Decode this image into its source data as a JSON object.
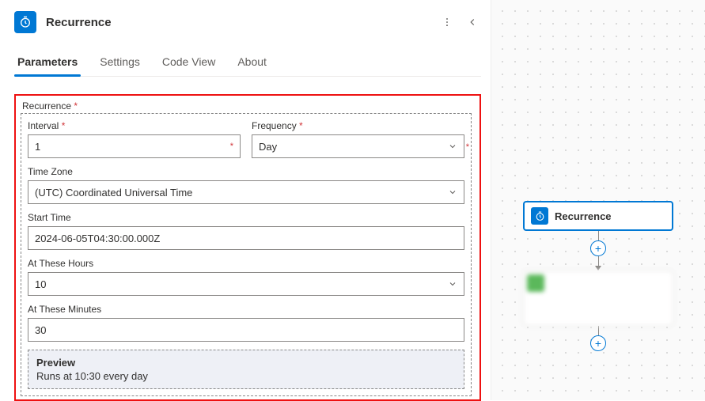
{
  "header": {
    "title": "Recurrence"
  },
  "tabs": {
    "parameters": "Parameters",
    "settings": "Settings",
    "codeview": "Code View",
    "about": "About"
  },
  "form": {
    "section_label": "Recurrence",
    "interval": {
      "label": "Interval",
      "value": "1"
    },
    "frequency": {
      "label": "Frequency",
      "value": "Day"
    },
    "timezone": {
      "label": "Time Zone",
      "value": "(UTC) Coordinated Universal Time"
    },
    "starttime": {
      "label": "Start Time",
      "value": "2024-06-05T04:30:00.000Z"
    },
    "hours": {
      "label": "At These Hours",
      "value": "10"
    },
    "minutes": {
      "label": "At These Minutes",
      "value": "30"
    },
    "preview": {
      "title": "Preview",
      "text": "Runs at 10:30 every day"
    }
  },
  "canvas": {
    "node1_label": "Recurrence"
  }
}
